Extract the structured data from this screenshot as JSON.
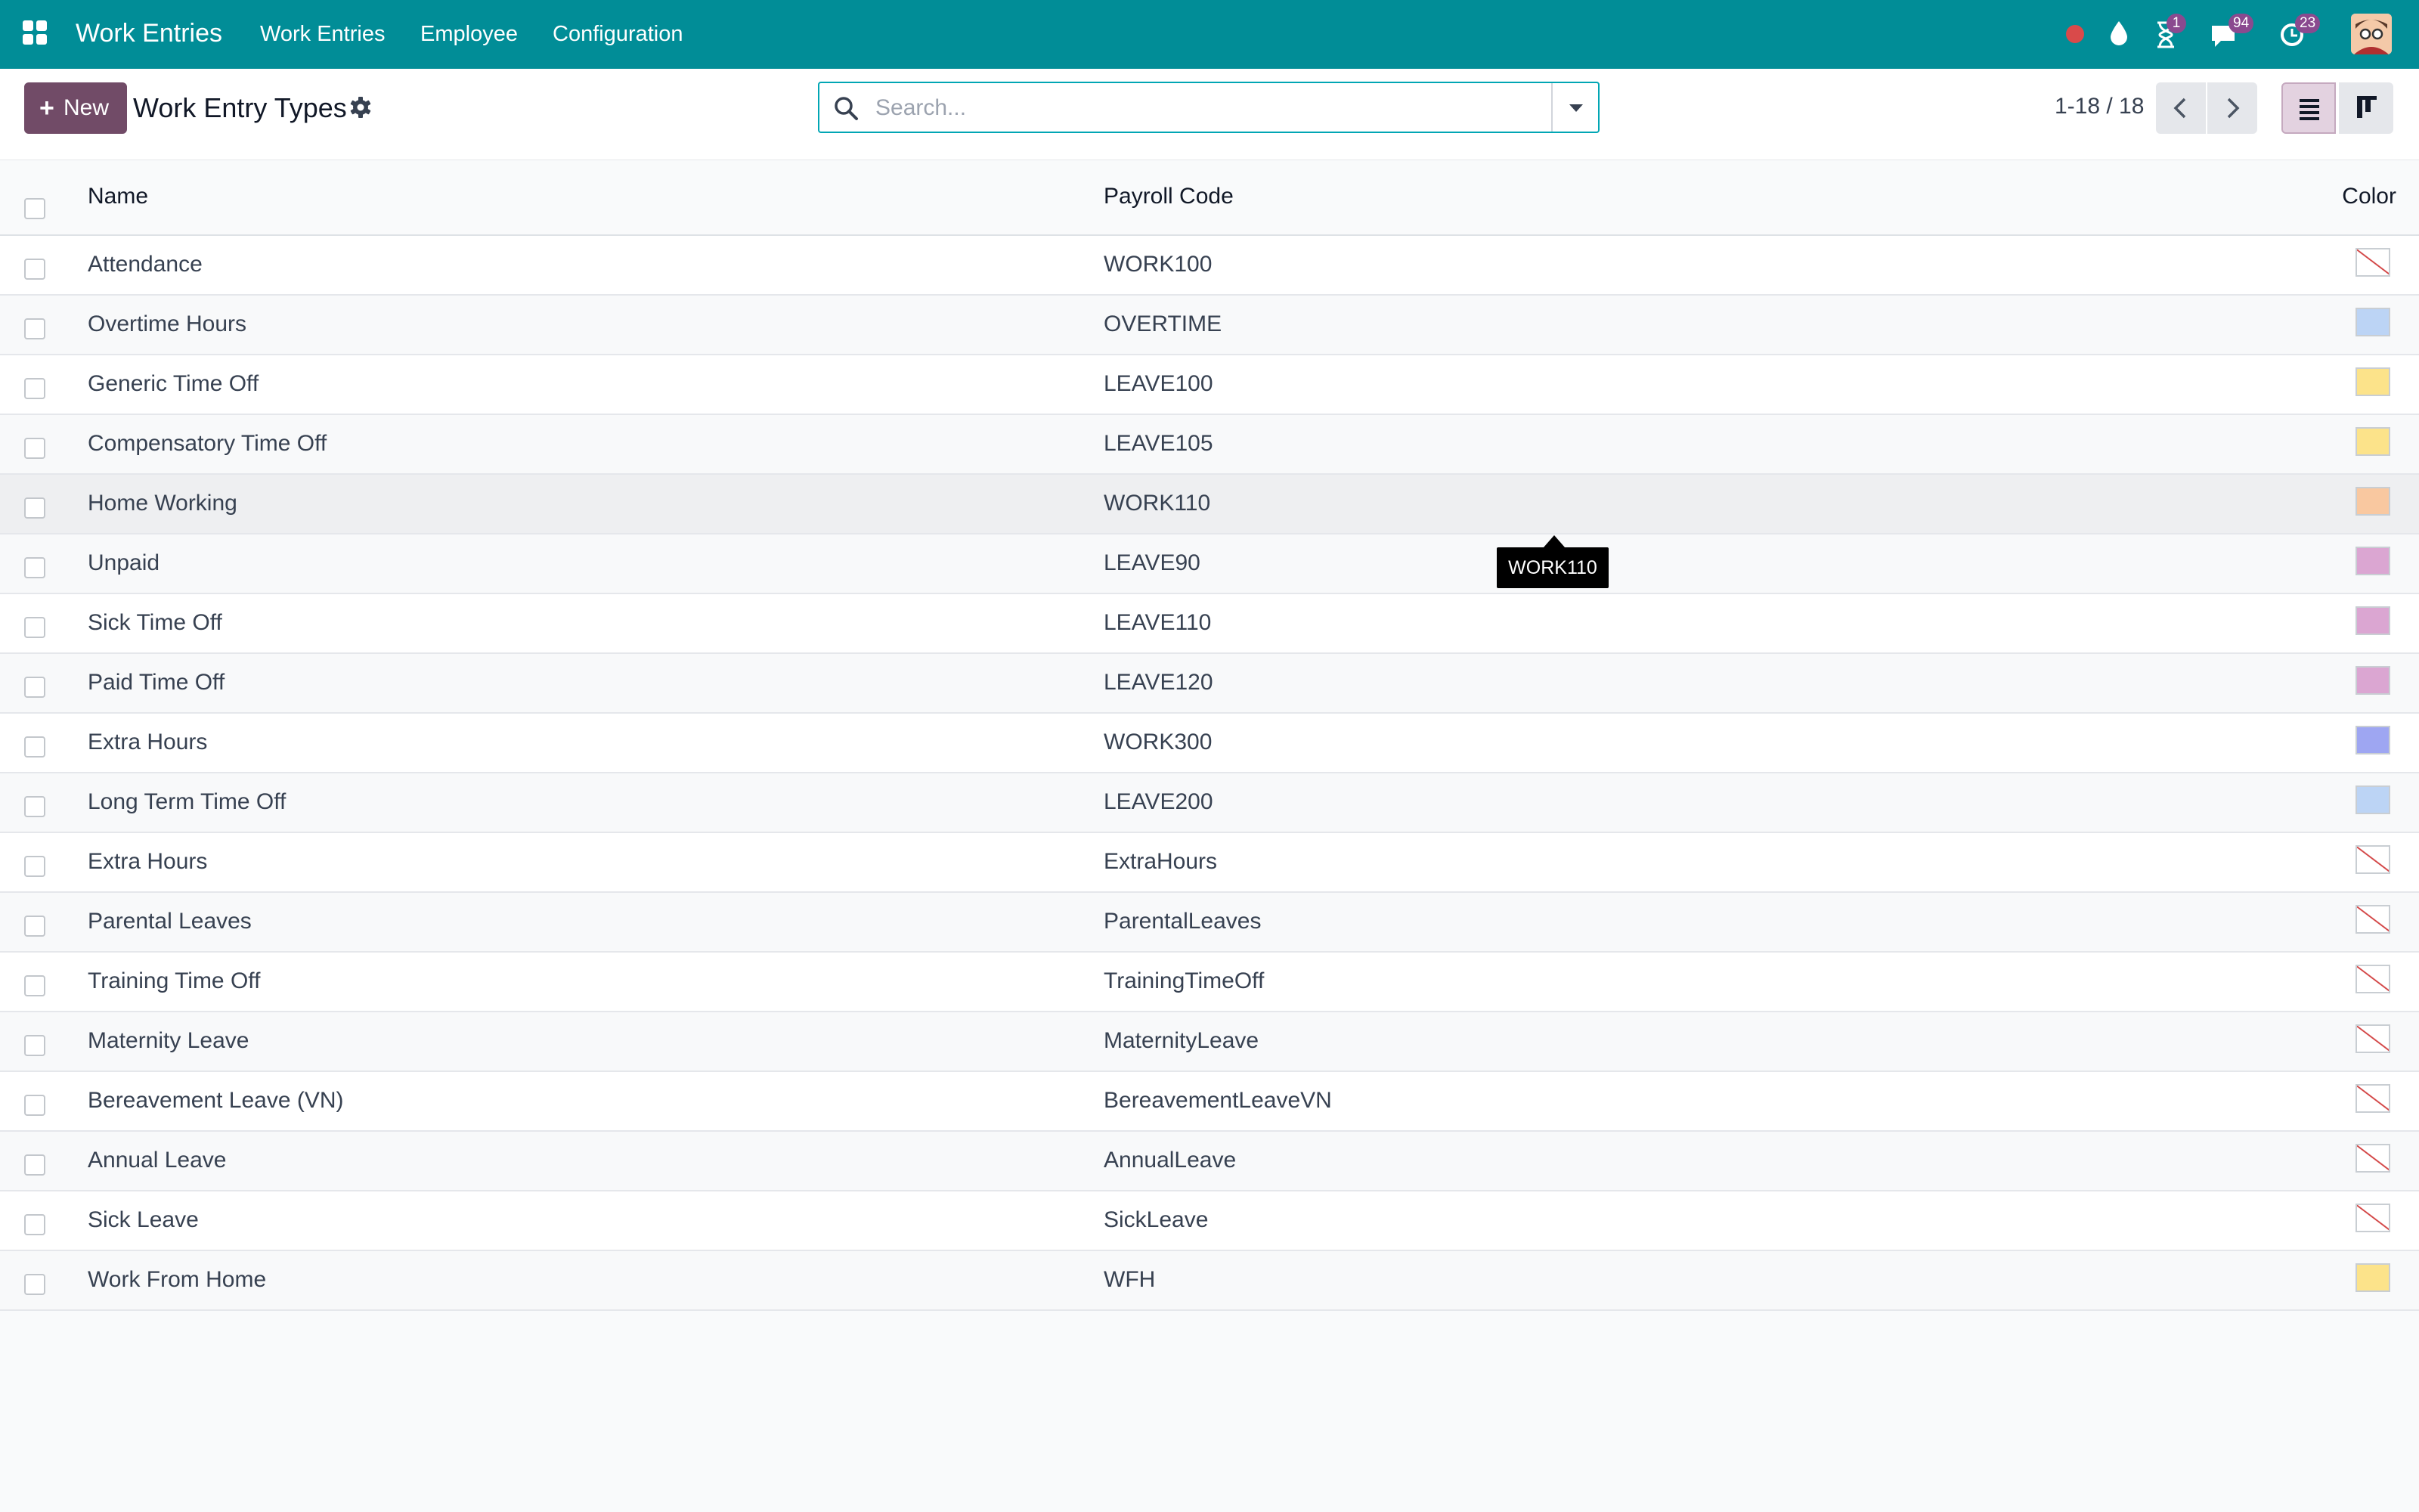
{
  "navbar": {
    "app_name": "Work Entries",
    "menus": [
      "Work Entries",
      "Employee",
      "Configuration"
    ],
    "activity_badge": "1",
    "messages_badge": "94",
    "timer_badge": "23",
    "icons": [
      "apps-grid-icon",
      "status-dot-icon",
      "droplet-icon",
      "hourglass-icon",
      "chat-icon",
      "clock-icon",
      "user-avatar"
    ]
  },
  "control_panel": {
    "new_label": "New",
    "title": "Work Entry Types",
    "search_placeholder": "Search...",
    "pager_label": "1-18 / 18"
  },
  "table": {
    "columns": {
      "name": "Name",
      "code": "Payroll Code",
      "color": "Color"
    },
    "rows": [
      {
        "name": "Attendance",
        "code": "WORK100",
        "color": "none"
      },
      {
        "name": "Overtime Hours",
        "code": "OVERTIME",
        "color": "#bcd4f5"
      },
      {
        "name": "Generic Time Off",
        "code": "LEAVE100",
        "color": "#fce38a"
      },
      {
        "name": "Compensatory Time Off",
        "code": "LEAVE105",
        "color": "#fce38a"
      },
      {
        "name": "Home Working",
        "code": "WORK110",
        "color": "#f9c8a0"
      },
      {
        "name": "Unpaid",
        "code": "LEAVE90",
        "color": "#dba6d2"
      },
      {
        "name": "Sick Time Off",
        "code": "LEAVE110",
        "color": "#dba6d2"
      },
      {
        "name": "Paid Time Off",
        "code": "LEAVE120",
        "color": "#dba6d2"
      },
      {
        "name": "Extra Hours",
        "code": "WORK300",
        "color": "#9ea6f2"
      },
      {
        "name": "Long Term Time Off",
        "code": "LEAVE200",
        "color": "#bcd4f5"
      },
      {
        "name": "Extra Hours",
        "code": "ExtraHours",
        "color": "none"
      },
      {
        "name": "Parental Leaves",
        "code": "ParentalLeaves",
        "color": "none"
      },
      {
        "name": "Training Time Off",
        "code": "TrainingTimeOff",
        "color": "none"
      },
      {
        "name": "Maternity Leave",
        "code": "MaternityLeave",
        "color": "none"
      },
      {
        "name": "Bereavement Leave (VN)",
        "code": "BereavementLeaveVN",
        "color": "none"
      },
      {
        "name": "Annual Leave",
        "code": "AnnualLeave",
        "color": "none"
      },
      {
        "name": "Sick Leave",
        "code": "SickLeave",
        "color": "none"
      },
      {
        "name": "Work From Home",
        "code": "WFH",
        "color": "#fce38a"
      }
    ],
    "hovered_row_index": 4
  },
  "tooltip": {
    "text": "WORK110"
  },
  "colors": {
    "navbar": "#018d97",
    "primary": "#714b67",
    "status_dot": "#d94a4a",
    "badge": "#8a4a8f"
  }
}
